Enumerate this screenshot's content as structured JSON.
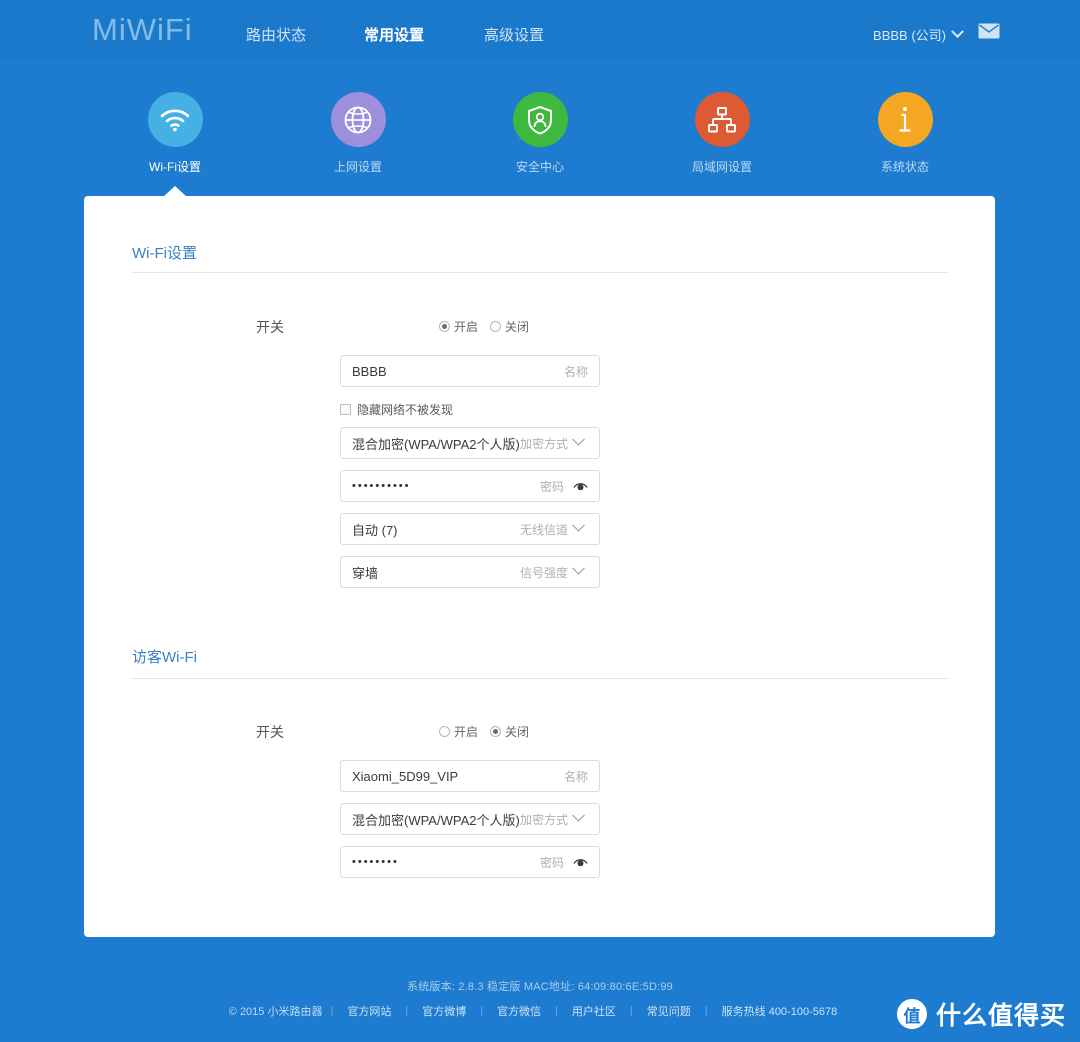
{
  "header": {
    "logo": "MiWiFi",
    "nav": [
      {
        "label": "路由状态",
        "active": false
      },
      {
        "label": "常用设置",
        "active": true
      },
      {
        "label": "高级设置",
        "active": false
      }
    ],
    "account": "BBBB (公司)",
    "account_chevron": "chevron-down-icon",
    "mail_icon": "mail-icon"
  },
  "iconnav": [
    {
      "label": "Wi-Fi设置",
      "icon": "wifi-icon",
      "color": "#45b0e3",
      "active": true
    },
    {
      "label": "上网设置",
      "icon": "globe-icon",
      "color": "#9e8fdd",
      "active": false
    },
    {
      "label": "安全中心",
      "icon": "shield-user-icon",
      "color": "#3fb83f",
      "active": false
    },
    {
      "label": "局域网设置",
      "icon": "network-topology-icon",
      "color": "#dd5a32",
      "active": false
    },
    {
      "label": "系统状态",
      "icon": "info-icon",
      "color": "#f5a623",
      "active": false
    }
  ],
  "wifi": {
    "section_title": "Wi-Fi设置",
    "switch_label": "开关",
    "switch_on_label": "开启",
    "switch_off_label": "关闭",
    "switch_state": "on",
    "ssid_value": "BBBB",
    "ssid_hint": "名称",
    "hide_network_label": "隐藏网络不被发现",
    "hide_network_checked": false,
    "encryption_value": "混合加密(WPA/WPA2个人版)",
    "encryption_hint": "加密方式",
    "password_value": "••••••••••",
    "password_hint": "密码",
    "password_eye_icon": "eye-icon",
    "channel_value": "自动 (7)",
    "channel_hint": "无线信道",
    "strength_value": "穿墙",
    "strength_hint": "信号强度"
  },
  "guest": {
    "section_title": "访客Wi-Fi",
    "switch_label": "开关",
    "switch_on_label": "开启",
    "switch_off_label": "关闭",
    "switch_state": "off",
    "ssid_value": "Xiaomi_5D99_VIP",
    "ssid_hint": "名称",
    "encryption_value": "混合加密(WPA/WPA2个人版)",
    "encryption_hint": "加密方式",
    "password_value": "••••••••",
    "password_hint": "密码",
    "password_eye_icon": "eye-icon"
  },
  "footer": {
    "sysinfo": "系统版本: 2.8.3 稳定版  MAC地址: 64:09:80:6E:5D:99",
    "copyright": "© 2015 小米路由器",
    "links": [
      "官方网站",
      "官方微博",
      "官方微信",
      "用户社区",
      "常见问题",
      "服务热线 400-100-5678"
    ],
    "separator": "|"
  },
  "watermark": {
    "badge": "值",
    "text": "什么值得买"
  }
}
